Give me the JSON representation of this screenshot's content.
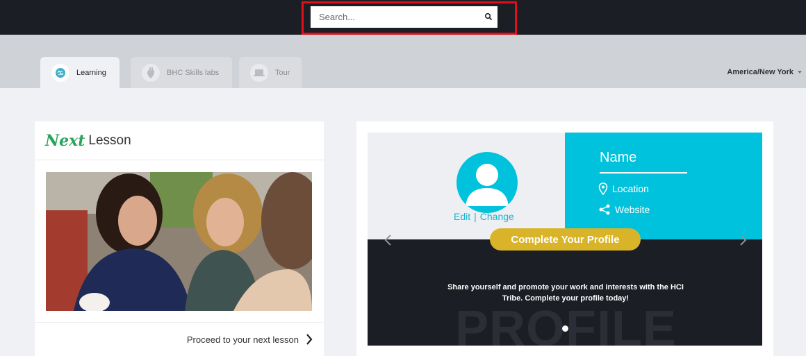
{
  "search": {
    "placeholder": "Search..."
  },
  "tabs": [
    {
      "label": "Learning",
      "icon": "brain-icon",
      "active": true
    },
    {
      "label": "BHC Skills labs",
      "icon": "heart-organ-icon",
      "active": false
    },
    {
      "label": "Tour",
      "icon": "laptop-icon",
      "active": false
    }
  ],
  "timezone": {
    "value": "America/New York"
  },
  "next_lesson": {
    "title_accent": "Next",
    "title_word": "Lesson",
    "proceed_label": "Proceed to your next lesson"
  },
  "profile": {
    "edit_label": "Edit",
    "separator": "|",
    "change_label": "Change",
    "name_label": "Name",
    "location_label": "Location",
    "website_label": "Website",
    "cta_label": "Complete Your Profile",
    "message": "Share yourself and promote your work and interests with the HCI Tribe. Complete your profile today!",
    "background_word": "PROFILE"
  },
  "colors": {
    "topbar": "#1b1e24",
    "accent_cyan": "#00c2dc",
    "cta_gold": "#d9b429",
    "next_green": "#2aa45b",
    "highlight_red": "#e0101a"
  }
}
